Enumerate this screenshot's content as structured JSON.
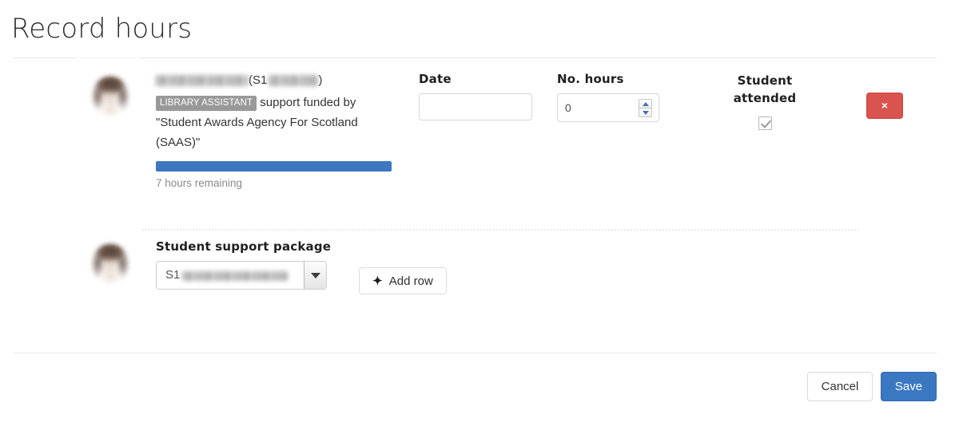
{
  "page": {
    "title": "Record hours"
  },
  "row1": {
    "avatar_alt": "student-photo",
    "student_name_redacted": "",
    "student_id_prefix": "(S1",
    "student_id_suffix": ")",
    "role_badge": "LIBRARY ASSISTANT",
    "funding_text_before": "support funded by",
    "funding_source_line1": "\"Student Awards Agency For Scotland",
    "funding_source_line2": "(SAAS)\"",
    "progress_percent": 100,
    "progress_caption": "7 hours remaining",
    "date": {
      "label": "Date",
      "value": "",
      "placeholder": ""
    },
    "hours": {
      "label": "No. hours",
      "value": "0"
    },
    "attended": {
      "label_line1": "Student",
      "label_line2": "attended",
      "checked": true
    },
    "remove": {
      "icon": "close-icon",
      "glyph": "×"
    }
  },
  "row2": {
    "package_label": "Student support package",
    "package_selected_prefix": "S1",
    "package_selected_redacted": "",
    "add_row_label": "Add row",
    "add_row_icon": "plus-icon",
    "add_row_glyph": "✦"
  },
  "footer": {
    "cancel_label": "Cancel",
    "save_label": "Save"
  },
  "colors": {
    "progress_blue": "#3c77bf",
    "danger_red": "#d9534f",
    "save_blue": "#3b78c2",
    "badge_gray": "#999999"
  }
}
